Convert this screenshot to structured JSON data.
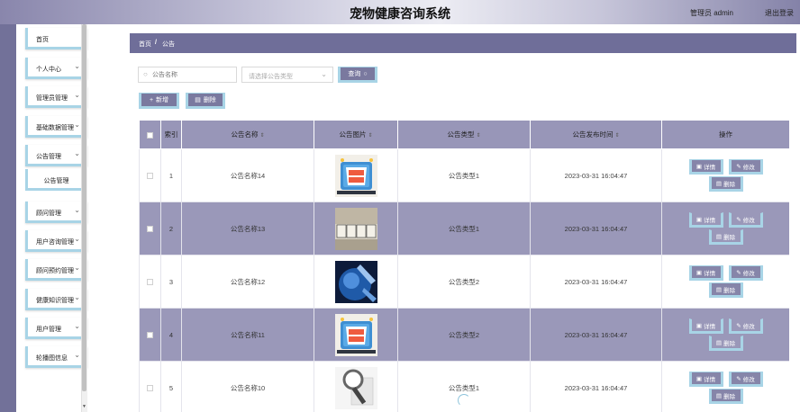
{
  "header": {
    "title": "宠物健康咨询系统",
    "user": "管理员 admin",
    "logout": "退出登录"
  },
  "sidebar": {
    "items": [
      {
        "label": "首页",
        "has_chevron": false
      },
      {
        "label": "个人中心",
        "has_chevron": true
      },
      {
        "label": "管理员管理",
        "has_chevron": true
      },
      {
        "label": "基础数据管理",
        "has_chevron": true
      },
      {
        "label": "公告管理",
        "has_chevron": true
      },
      {
        "label": "公告管理",
        "sub": true
      },
      {
        "label": "顾问管理",
        "has_chevron": true
      },
      {
        "label": "用户咨询管理",
        "has_chevron": true
      },
      {
        "label": "顾问预约管理",
        "has_chevron": true
      },
      {
        "label": "健康知识管理",
        "has_chevron": true
      },
      {
        "label": "用户管理",
        "has_chevron": true
      },
      {
        "label": "轮播图信息",
        "has_chevron": true
      }
    ]
  },
  "breadcrumb": {
    "home": "首页",
    "sep": "/",
    "current": "公告"
  },
  "search": {
    "name_placeholder": "公告名称",
    "type_placeholder": "请选择公告类型",
    "search_label": "查询"
  },
  "toolbar": {
    "add_label": "新增",
    "delete_label": "删除"
  },
  "table": {
    "columns": [
      "索引",
      "公告名称",
      "公告图片",
      "公告类型",
      "公告发布时间",
      "操作"
    ],
    "rows": [
      {
        "index": "1",
        "name": "公告名称14",
        "image": "热点新闻",
        "type": "公告类型1",
        "time": "2023-03-31 16:04:47"
      },
      {
        "index": "2",
        "name": "公告名称13",
        "image": "NEWS",
        "type": "公告类型1",
        "time": "2023-03-31 16:04:47"
      },
      {
        "index": "3",
        "name": "公告名称12",
        "image": "",
        "type": "公告类型2",
        "time": "2023-03-31 16:04:47"
      },
      {
        "index": "4",
        "name": "公告名称11",
        "image": "热点新闻",
        "type": "公告类型2",
        "time": "2023-03-31 16:04:47"
      },
      {
        "index": "5",
        "name": "公告名称10",
        "image": "",
        "type": "公告类型1",
        "time": "2023-03-31 16:04:47"
      }
    ],
    "actions": {
      "detail": "详情",
      "edit": "修改",
      "delete": "删除"
    }
  },
  "colors": {
    "accent": "#6f6e99",
    "row_alt": "#9a98b9",
    "button_border": "#a8d4e6"
  }
}
